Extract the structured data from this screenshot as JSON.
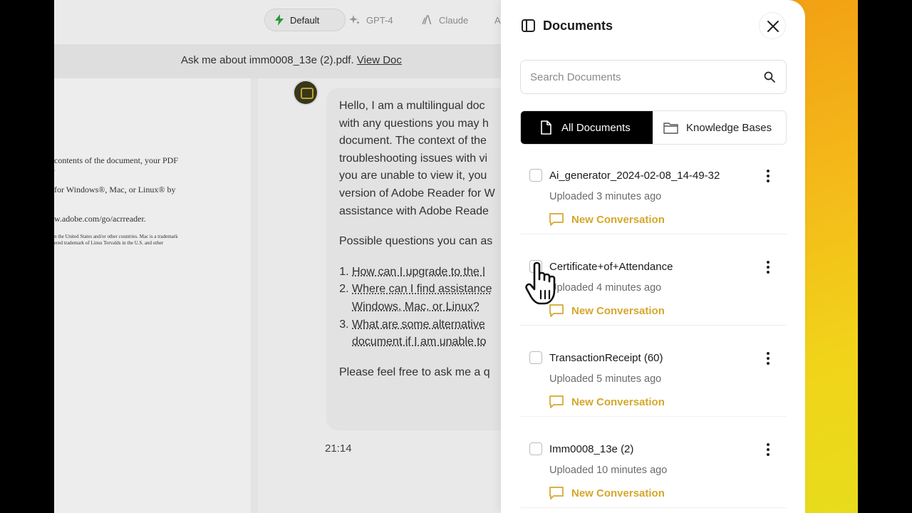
{
  "background_app": {
    "model_tabs": [
      {
        "label": "Default",
        "icon": "bolt-icon"
      },
      {
        "label": "GPT-4",
        "icon": "sparkle-icon"
      },
      {
        "label": "Claude",
        "icon": "claude-icon"
      },
      {
        "label": "A",
        "icon": ""
      }
    ],
    "ask_prefix": "Ask me about imm0008_13e (2).pdf.",
    "ask_link": "View Doc",
    "pdf_lines": [
      "contents of the document, your PDF",
      ".",
      "for Windows®, Mac, or Linux® by",
      "w.adobe.com/go/acrreader.",
      "n the United States and/or other countries. Mac is a trademark",
      "ered trademark of Linus Torvalds in the U.S. and other"
    ],
    "message": {
      "intro_lines": [
        "Hello, I am a multilingual doc",
        "with any questions you may h",
        "document. The context of the",
        "troubleshooting issues with vi",
        "you are unable to view it, you",
        "version of Adobe Reader for W",
        "assistance with Adobe Reade"
      ],
      "questions_intro": "Possible questions you can as",
      "questions": [
        "How can I upgrade to the l",
        "Where can I find assistance Windows, Mac, or Linux?",
        "What are some alternative document if I am unable to"
      ],
      "closing": "Please feel free to ask me a q"
    },
    "timestamp": "21:14"
  },
  "drawer": {
    "title": "Documents",
    "search_placeholder": "Search Documents",
    "tabs": {
      "all": "All Documents",
      "kb": "Knowledge Bases"
    },
    "documents": [
      {
        "name": "Ai_generator_2024-02-08_14-49-32",
        "uploaded": "Uploaded 3 minutes ago",
        "action": "New Conversation"
      },
      {
        "name": "Certificate+of+Attendance",
        "uploaded": "Uploaded 4 minutes ago",
        "action": "New Conversation"
      },
      {
        "name": "TransactionReceipt (60)",
        "uploaded": "Uploaded 5 minutes ago",
        "action": "New Conversation"
      },
      {
        "name": "Imm0008_13e (2)",
        "uploaded": "Uploaded 10 minutes ago",
        "action": "New Conversation"
      }
    ]
  },
  "colors": {
    "accent": "#d4a72c",
    "tab_active_bg": "#000000",
    "gradient_start": "#f2a014",
    "gradient_end": "#e7dc1c"
  }
}
